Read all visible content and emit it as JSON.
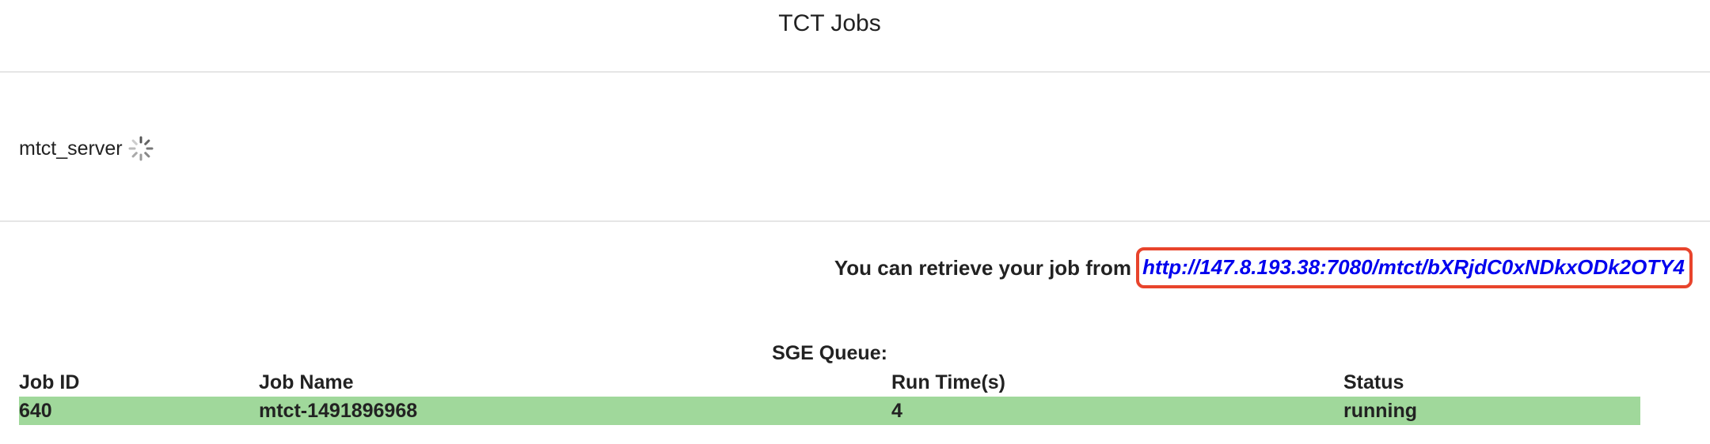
{
  "header": {
    "title": "TCT Jobs"
  },
  "server": {
    "name": "mtct_server",
    "status_icon": "loading-spinner-icon"
  },
  "retrieve": {
    "text": "You can retrieve your job from",
    "link": "http://147.8.193.38:7080/mtct/bXRjdC0xNDkxODk2OTY4"
  },
  "queue": {
    "title": "SGE Queue:",
    "columns": [
      "Job ID",
      "Job Name",
      "Run Time(s)",
      "Status"
    ],
    "rows": [
      {
        "job_id": "640",
        "job_name": "mtct-1491896968",
        "run_time": "4",
        "status": "running"
      }
    ]
  },
  "colors": {
    "row_running": "#a0d89b",
    "link": "#0000ee",
    "highlight_border": "#e8442c"
  }
}
